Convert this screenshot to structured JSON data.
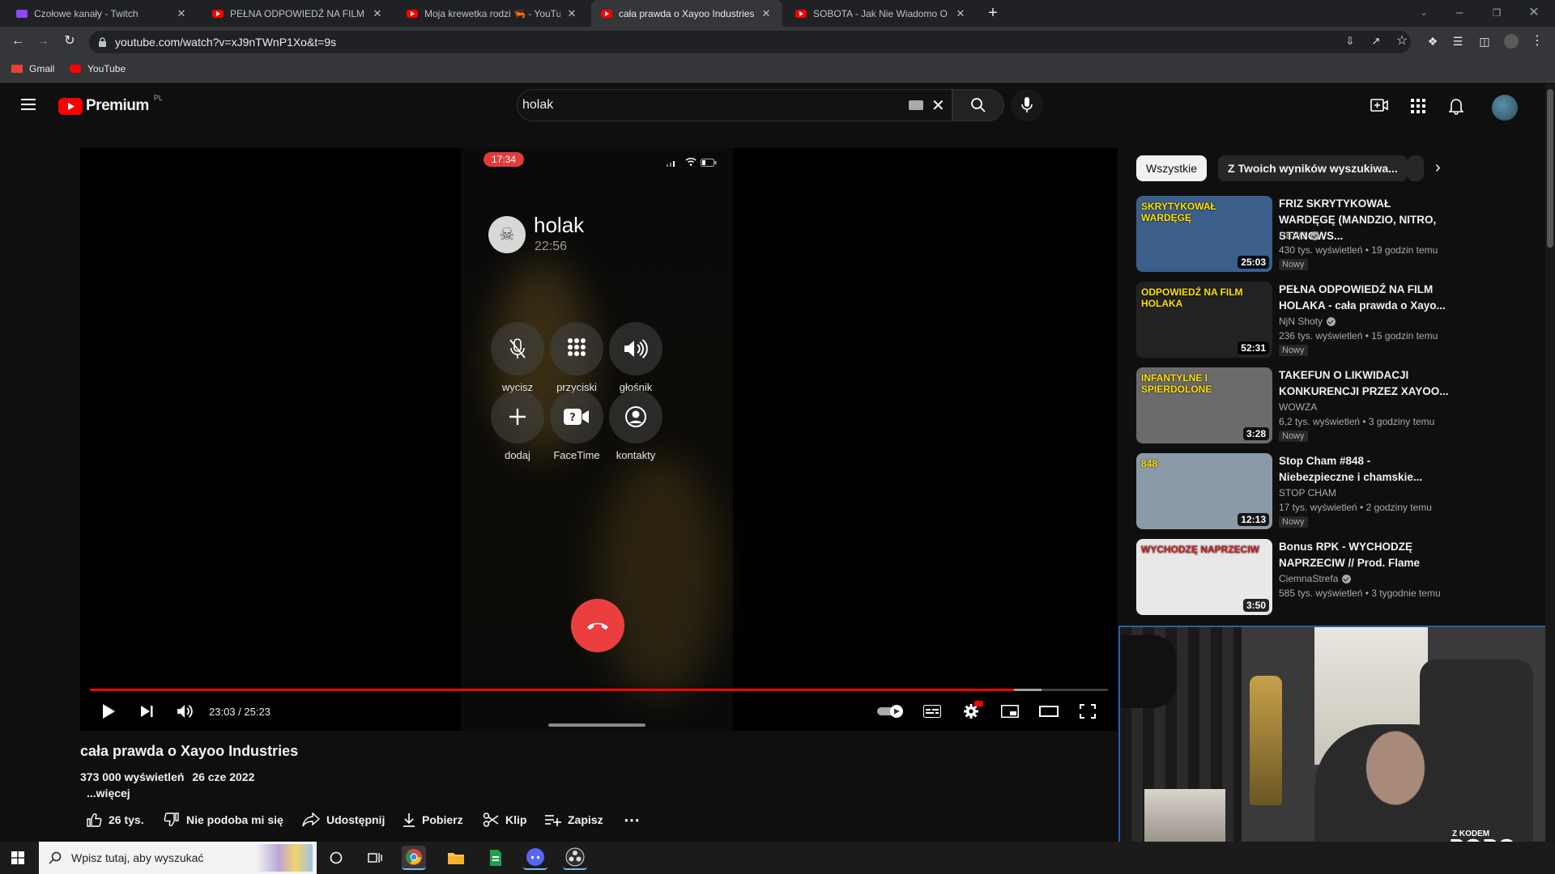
{
  "browser": {
    "tabs": [
      {
        "title": "Czołowe kanały - Twitch",
        "icon": "twitch-icon",
        "active": false
      },
      {
        "title": "PEŁNA ODPOWIEDŹ NA FILM HO",
        "icon": "youtube-icon",
        "active": false
      },
      {
        "title": "Moja krewetka rodzi 🦐 - YouTu",
        "icon": "youtube-icon",
        "active": false
      },
      {
        "title": "cała prawda o Xayoo Industries -",
        "icon": "youtube-icon",
        "active": true
      },
      {
        "title": "SOBOTA - Jak Nie Wiadomo O C",
        "icon": "youtube-icon",
        "active": false
      }
    ],
    "new_tab": "+",
    "url": "youtube.com/watch?v=xJ9nTWnP1Xo&t=9s",
    "bookmarks": [
      "Gmail",
      "YouTube"
    ]
  },
  "youtube": {
    "logo_text": "Premium",
    "region": "PL",
    "search_value": "holak"
  },
  "video": {
    "phone": {
      "status_time": "17:34",
      "caller": "holak",
      "call_duration": "22:56",
      "buttons": [
        {
          "label": "wycisz",
          "icon": "mic-off-icon"
        },
        {
          "label": "przyciski",
          "icon": "keypad-icon"
        },
        {
          "label": "głośnik",
          "icon": "speaker-icon"
        },
        {
          "label": "dodaj",
          "icon": "plus-icon"
        },
        {
          "label": "FaceTime",
          "icon": "facetime-icon"
        },
        {
          "label": "kontakty",
          "icon": "contacts-icon"
        }
      ]
    },
    "time_display": "23:03 / 25:23",
    "progress": 0.908,
    "buffered": 0.935
  },
  "info": {
    "title": "cała prawda o Xayoo Industries",
    "views": "373 000 wyświetleń",
    "date": "26 cze 2022",
    "more": "...więcej",
    "actions": {
      "likes": "26 tys.",
      "dislike": "Nie podoba mi się",
      "share": "Udostępnij",
      "download": "Pobierz",
      "clip": "Klip",
      "save": "Zapisz"
    }
  },
  "chips": [
    "Wszystkie",
    "Z Twoich wyników wyszukiwa..."
  ],
  "recommendations": [
    {
      "title": "FRIZ SKRYTYKOWAŁ WARDĘGĘ (MANDZIO, NITRO, STANOWS...",
      "channel": "REVO",
      "verified": true,
      "stats": "430 tys. wyświetleń • 19 godzin temu",
      "badge": "Nowy",
      "duration": "25:03",
      "thumb_text": "SKRYTYKOWAŁ WARDĘGĘ",
      "thumb_color": "#3b5f8a"
    },
    {
      "title": "PEŁNA ODPOWIEDŹ NA FILM HOLAKA - cała prawda o Xayo...",
      "channel": "NjN Shoty",
      "verified": true,
      "stats": "236 tys. wyświetleń • 15 godzin temu",
      "badge": "Nowy",
      "duration": "52:31",
      "thumb_text": "ODPOWIEDŹ NA FILM HOLAKA",
      "thumb_color": "#222222"
    },
    {
      "title": "TAKEFUN O LIKWIDACJI KONKURENCJI PRZEZ XAYOO...",
      "channel": "WOWZA",
      "verified": false,
      "stats": "6,2 tys. wyświetleń • 3 godziny temu",
      "badge": "Nowy",
      "duration": "3:28",
      "thumb_text": "INFANTYLNE I SPIERDOLONE",
      "thumb_color": "#6b6b6b"
    },
    {
      "title": "Stop Cham #848 - Niebezpieczne i chamskie...",
      "channel": "STOP CHAM",
      "verified": false,
      "stats": "17 tys. wyświetleń • 2 godziny temu",
      "badge": "Nowy",
      "duration": "12:13",
      "thumb_text": "848",
      "thumb_color": "#8a9aa8"
    },
    {
      "title": "Bonus RPK - WYCHODZĘ NAPRZECIW // Prod. Flame",
      "channel": "CiemnaStrefa",
      "verified": true,
      "stats": "585 tys. wyświetleń • 3 tygodnie temu",
      "badge": "",
      "duration": "3:50",
      "thumb_text": "WYCHODZĘ NAPRZECIW",
      "thumb_color": "#e8e8e8"
    }
  ],
  "webcam": {
    "watermark": "POPO",
    "watermark_small": "Z KODEM"
  },
  "taskbar": {
    "search_placeholder": "Wpisz tutaj, aby wyszukać"
  },
  "colors": {
    "accent": "#ff0000",
    "background": "#0f0f0f",
    "end_call": "#eb3f3f"
  }
}
